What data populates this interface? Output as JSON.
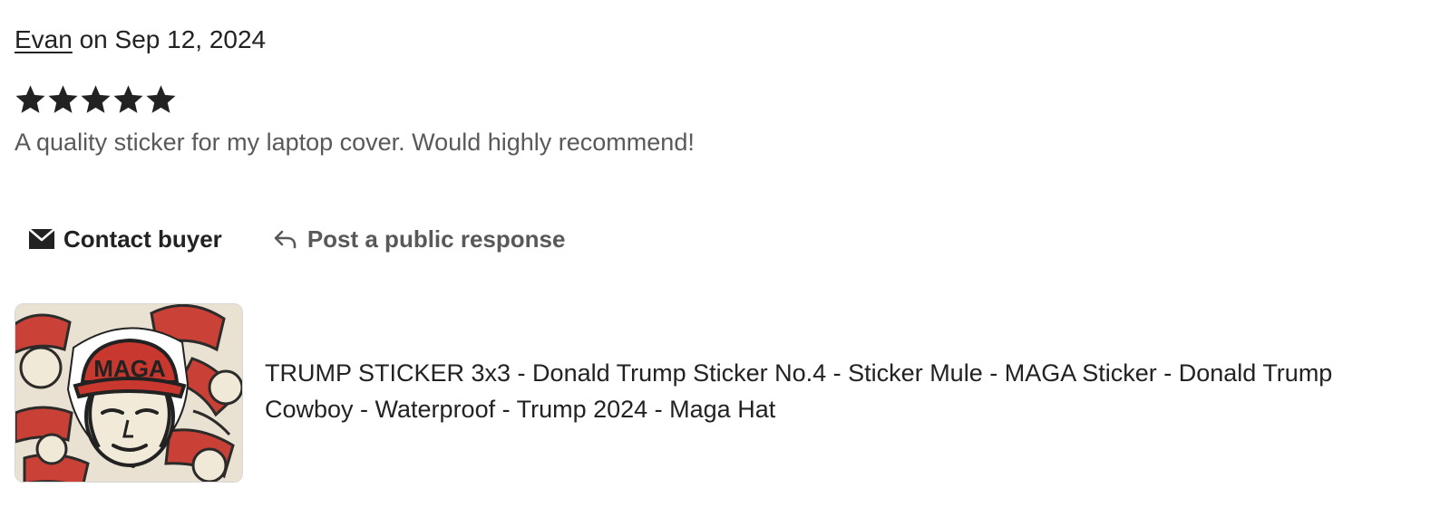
{
  "review": {
    "reviewer_name": "Evan",
    "date_text": " on Sep 12, 2024",
    "rating": 5,
    "rating_max": 5,
    "text": "A quality sticker for my laptop cover. Would highly recommend!"
  },
  "actions": {
    "contact_label": "Contact buyer",
    "contact_icon": "envelope-icon",
    "respond_label": "Post a public response",
    "respond_icon": "reply-arrow-icon"
  },
  "listing": {
    "title": "TRUMP STICKER 3x3 - Donald Trump Sticker No.4 - Sticker Mule - MAGA Sticker - Donald Trump Cowboy - Waterproof - Trump 2024 - Maga Hat",
    "image_hat_text": "MAGA"
  },
  "colors": {
    "text_primary": "#222222",
    "text_secondary": "#595959",
    "sticker_red": "#c8382f"
  }
}
